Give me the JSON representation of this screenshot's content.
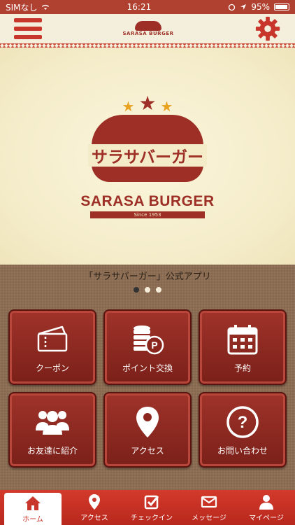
{
  "status_bar": {
    "carrier": "SIMなし",
    "time": "16:21",
    "battery": "95%"
  },
  "header": {
    "logo_text": "SARASA BURGER"
  },
  "hero": {
    "logo_jp": "サラサバーガー",
    "brand_name": "SARASA BURGER",
    "since": "Since 1953"
  },
  "caption": "「サラサバーガー」公式アプリ",
  "carousel": {
    "pages": 3,
    "active": 1
  },
  "tiles": [
    {
      "label": "クーポン",
      "icon": "ticket-icon"
    },
    {
      "label": "ポイント交換",
      "icon": "coins-point-icon"
    },
    {
      "label": "予約",
      "icon": "calendar-icon"
    },
    {
      "label": "お友達に紹介",
      "icon": "people-icon"
    },
    {
      "label": "アクセス",
      "icon": "map-pin-icon"
    },
    {
      "label": "お問い合わせ",
      "icon": "question-icon"
    }
  ],
  "bottom_nav": [
    {
      "label": "ホーム",
      "icon": "home-icon",
      "active": true
    },
    {
      "label": "アクセス",
      "icon": "map-pin-icon",
      "active": false
    },
    {
      "label": "チェックイン",
      "icon": "checkin-icon",
      "active": false
    },
    {
      "label": "メッセージ",
      "icon": "envelope-icon",
      "active": false
    },
    {
      "label": "マイページ",
      "icon": "user-icon",
      "active": false
    }
  ],
  "colors": {
    "brand": "#9d2f26",
    "accent": "#c8352a",
    "star": "#e8a21f",
    "cream": "#f4ecc9"
  }
}
